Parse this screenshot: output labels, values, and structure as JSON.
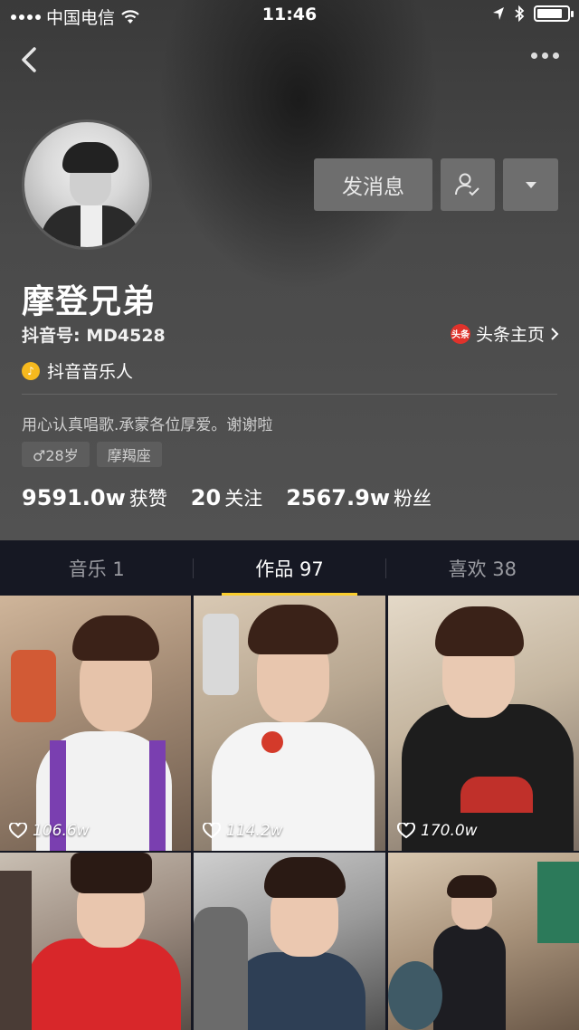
{
  "status_bar": {
    "carrier": "中国电信",
    "time": "11:46",
    "battery_level": 0.85
  },
  "profile": {
    "name": "摩登兄弟",
    "douyin_id": "抖音号: MD4528",
    "toutiao_logo": "头条",
    "toutiao_label": "头条主页",
    "verify_label": "抖音音乐人",
    "bio": "用心认真唱歌.承蒙各位厚爱。谢谢啦",
    "tags": [
      "♂28岁",
      "摩羯座"
    ],
    "message_button": "发消息",
    "stats": [
      {
        "value": "9591.0w",
        "label": "获赞"
      },
      {
        "value": "20",
        "label": "关注"
      },
      {
        "value": "2567.9w",
        "label": "粉丝"
      }
    ]
  },
  "tabs": [
    {
      "label": "音乐 1",
      "active": false
    },
    {
      "label": "作品 97",
      "active": true
    },
    {
      "label": "喜欢 38",
      "active": false
    }
  ],
  "videos": [
    {
      "likes": "106.6w"
    },
    {
      "likes": "114.2w"
    },
    {
      "likes": "170.0w"
    },
    {
      "likes": ""
    },
    {
      "likes": ""
    },
    {
      "likes": ""
    }
  ],
  "colors": {
    "accent": "#facd2d",
    "background": "#161823",
    "toutiao_red": "#e0322b"
  }
}
